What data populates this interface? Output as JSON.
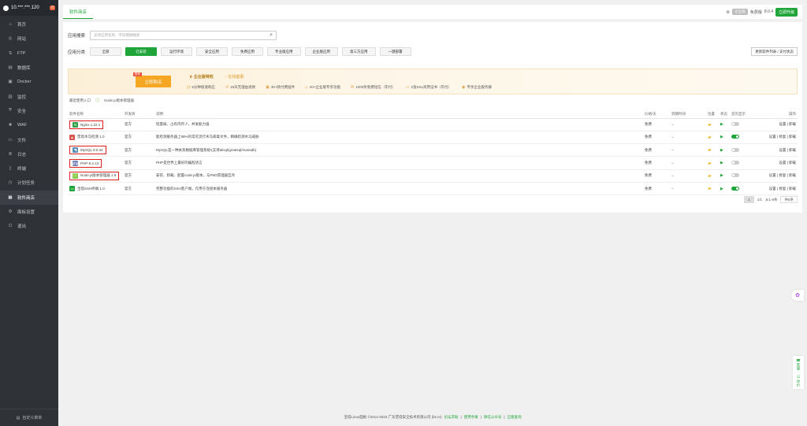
{
  "sidebar": {
    "server": "10.***.***.120",
    "badge": "0",
    "items": [
      {
        "label": "首页",
        "icon": "home-icon",
        "glyph": "⌂"
      },
      {
        "label": "网站",
        "icon": "globe-icon",
        "glyph": "◎"
      },
      {
        "label": "FTP",
        "icon": "ftp-icon",
        "glyph": "⇅"
      },
      {
        "label": "数据库",
        "icon": "database-icon",
        "glyph": "▤"
      },
      {
        "label": "Docker",
        "icon": "docker-icon",
        "glyph": "▣"
      },
      {
        "label": "监控",
        "icon": "monitor-icon",
        "glyph": "▥"
      },
      {
        "label": "安全",
        "icon": "shield-icon",
        "glyph": "⛨"
      },
      {
        "label": "WAF",
        "icon": "waf-icon",
        "glyph": "✺"
      },
      {
        "label": "文件",
        "icon": "folder-icon",
        "glyph": "▭"
      },
      {
        "label": "日志",
        "icon": "log-icon",
        "glyph": "≣"
      },
      {
        "label": "终端",
        "icon": "terminal-icon",
        "glyph": "▯"
      },
      {
        "label": "计划任务",
        "icon": "clock-icon",
        "glyph": "◷"
      },
      {
        "label": "软件商店",
        "icon": "store-icon",
        "glyph": "▦"
      },
      {
        "label": "面板设置",
        "icon": "gear-icon",
        "glyph": "⚙"
      },
      {
        "label": "退出",
        "icon": "logout-icon",
        "glyph": "⏻"
      }
    ],
    "active_index": 12,
    "bottom_label": "自定义菜单"
  },
  "topbar": {
    "tab": "软件商店",
    "vip": "企业版",
    "version_label": "免费版",
    "version": "8.0.4",
    "buy": "立即升级"
  },
  "search": {
    "label": "应用搜索",
    "placeholder": "支持应用名称、字段模糊搜索"
  },
  "categories": {
    "label": "应用分类",
    "items": [
      "全部",
      "已安装",
      "运行环境",
      "安全应用",
      "免费应用",
      "专业版应用",
      "企业版应用",
      "第三方应用",
      "一键部署"
    ],
    "active_index": 1,
    "update_btn": "更新软件列表 / 支付状态"
  },
  "banner": {
    "buy_now": "立即购买",
    "tag": "推荐",
    "title1": "企业版特权",
    "title2": "在线客服",
    "features": [
      "5分钟极速响应",
      "15天无理由退款",
      "30+款付费插件",
      "20+企业版专享功能",
      "1000条免费短信（年付）",
      "2张SSL商用证书（年付）",
      "专享企业服务群"
    ]
  },
  "recent": {
    "label": "最近使用入口",
    "item": "Node.js版本管理器"
  },
  "table": {
    "headers": [
      "软件名称",
      "开发商",
      "说明",
      "价格/天",
      "到期时间",
      "位置",
      "状态",
      "首页显示",
      "操作"
    ],
    "rows": [
      {
        "name": "Nginx 1.22.1",
        "dev": "官方",
        "desc": "轻量级、占有内存少，并发能力强",
        "price": "免费",
        "expire": "--",
        "toggle": false,
        "ops": "设置 | 卸载",
        "icon": "nginx-icon",
        "iconColor": "#2e9e47",
        "glyph": "N",
        "boxed": true,
        "running": true
      },
      {
        "name": "堡塔木马检测 1.0",
        "dev": "官方",
        "desc": "能检测服务器上99%的常见流行木马病毒文件，精确检测木马威胁",
        "price": "免费",
        "expire": "--",
        "toggle": true,
        "ops": "设置 | 修复 | 卸载",
        "icon": "trojan-scan-icon",
        "iconColor": "#d9534f",
        "glyph": "▲",
        "boxed": false,
        "running": false
      },
      {
        "name": "MySQL 8.0.34",
        "dev": "官方",
        "desc": "MySQL是一种关系数据库管理系统!(支持alisql/greatsql/mariadb)",
        "price": "免费",
        "expire": "--",
        "toggle": false,
        "ops": "设置 | 卸载",
        "icon": "mysql-icon",
        "iconColor": "#5b8fb9",
        "glyph": "◥",
        "boxed": true,
        "running": true
      },
      {
        "name": "PHP-8.2.13",
        "dev": "官方",
        "desc": "PHP是世界上最好的编程语言",
        "price": "免费",
        "expire": "--",
        "toggle": false,
        "ops": "设置 | 卸载",
        "icon": "php-icon",
        "iconColor": "#7a86b8",
        "glyph": "php",
        "boxed": true,
        "running": false
      },
      {
        "name": "Node.js版本管理器 1.9",
        "dev": "官方",
        "desc": "安装、卸载、配置node.js版本，与PM2管理器互斥",
        "price": "免费",
        "expire": "--",
        "toggle": false,
        "ops": "设置 | 修复 | 卸载",
        "icon": "nodejs-icon",
        "iconColor": "#8cc84b",
        "glyph": "⬡",
        "boxed": true,
        "running": false
      },
      {
        "name": "宝塔SSH终端 1.0",
        "dev": "官方",
        "desc": "完整功能的SSH客户端，仅用于连接本服务器",
        "price": "免费",
        "expire": "--",
        "toggle": true,
        "ops": "设置 | 修复 | 卸载",
        "icon": "ssh-terminal-icon",
        "iconColor": "#20a53a",
        "glyph": "▭",
        "boxed": false,
        "running": false
      }
    ]
  },
  "pager": {
    "current": "1",
    "pages": "1/1",
    "range": "从1-6条",
    "total": "共6条"
  },
  "side_tools": {
    "service": "客服",
    "review": "评价"
  },
  "footer": {
    "copyright": "宝塔Linux面板 ©2014-2023 广东堡塔安全技术有限公司 (bt.cn)",
    "links": [
      "论坛求助",
      "使用手册",
      "微信公众号",
      "正版查询"
    ]
  },
  "colors": {
    "accent": "#20a53a",
    "sidebar": "#2f3338",
    "highlight": "#e02020"
  }
}
